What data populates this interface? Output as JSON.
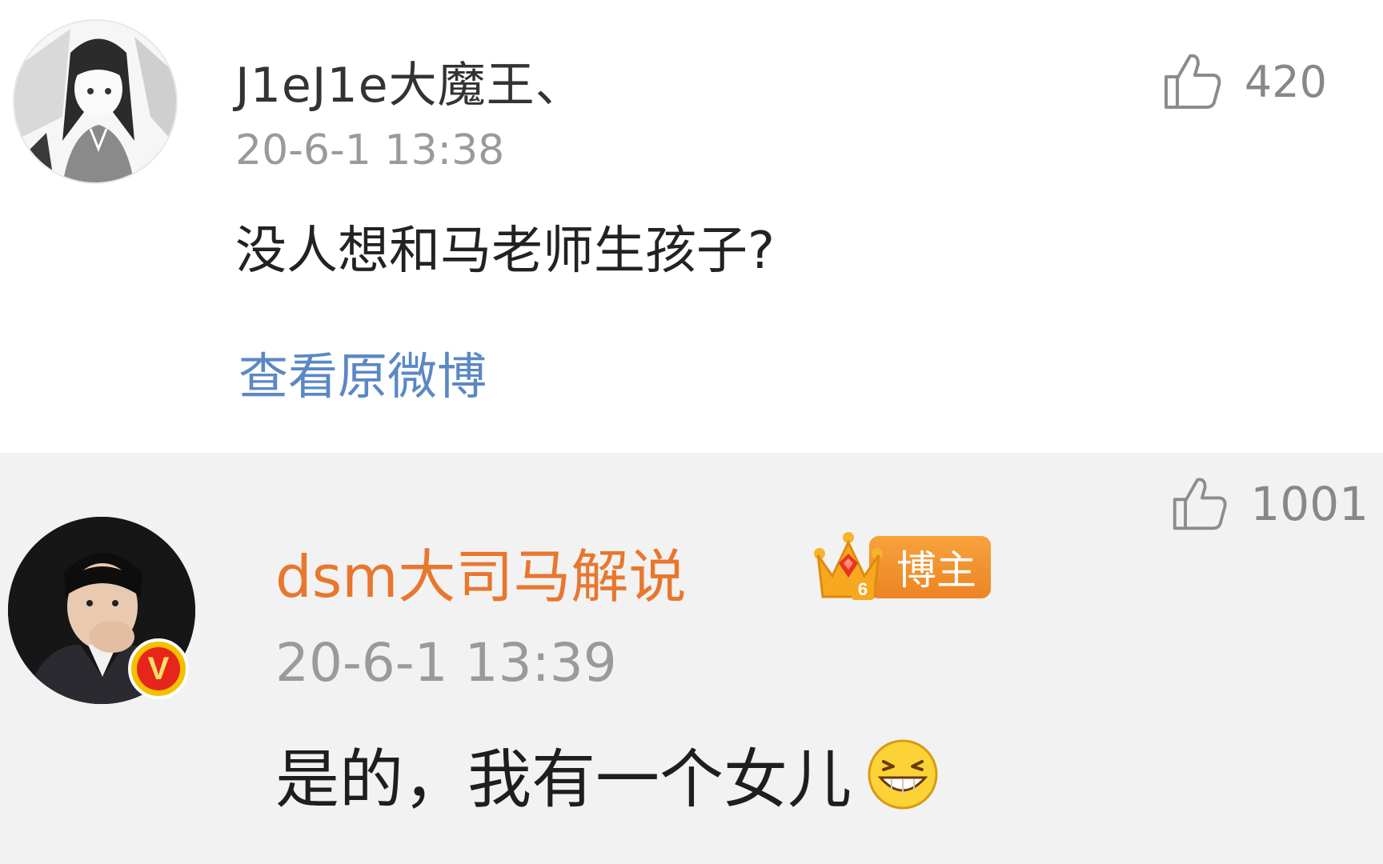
{
  "comment": {
    "username": "J1eJ1e大魔王、",
    "timestamp": "20-6-1 13:38",
    "text": "没人想和马老师生孩子?",
    "view_original_label": "查看原微博",
    "like_count": "420",
    "avatar_icon": "manga-avatar-icon"
  },
  "reply": {
    "username": "dsm大司马解说",
    "badge_level": "6",
    "badge_label": "博主",
    "timestamp": "20-6-1 13:39",
    "text": "是的，我有一个女儿",
    "emoji": "grin-emoji",
    "like_count": "1001",
    "verified_mark": "V",
    "avatar_icon": "man-in-suit-avatar-icon"
  },
  "colors": {
    "link_blue": "#5b88c5",
    "blogger_orange": "#e8772e",
    "badge_orange": "#ec8424",
    "reply_background": "#f2f2f2",
    "muted_gray": "#9a9a9a"
  }
}
